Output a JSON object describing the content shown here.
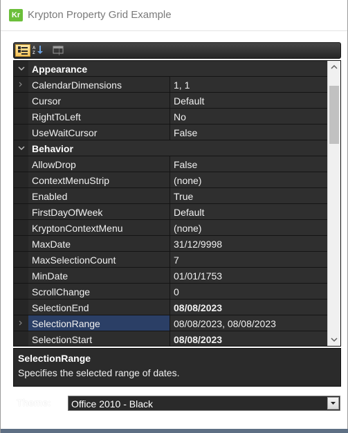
{
  "window": {
    "title": "Krypton Property Grid Example",
    "icon_text": "Kr"
  },
  "toolbar": {
    "buttons": [
      {
        "icon": "categorized-icon",
        "active": true
      },
      {
        "icon": "alphabetical-sort-icon",
        "active": false
      },
      {
        "icon": "property-pages-icon",
        "active": false
      }
    ]
  },
  "grid": {
    "categories": [
      {
        "label": "Appearance",
        "properties": [
          {
            "name": "CalendarDimensions",
            "value": "1, 1",
            "expandable": true,
            "bold": false
          },
          {
            "name": "Cursor",
            "value": "Default",
            "expandable": false,
            "bold": false
          },
          {
            "name": "RightToLeft",
            "value": "No",
            "expandable": false,
            "bold": false
          },
          {
            "name": "UseWaitCursor",
            "value": "False",
            "expandable": false,
            "bold": false
          }
        ]
      },
      {
        "label": "Behavior",
        "properties": [
          {
            "name": "AllowDrop",
            "value": "False",
            "expandable": false,
            "bold": false
          },
          {
            "name": "ContextMenuStrip",
            "value": "(none)",
            "expandable": false,
            "bold": false
          },
          {
            "name": "Enabled",
            "value": "True",
            "expandable": false,
            "bold": false
          },
          {
            "name": "FirstDayOfWeek",
            "value": "Default",
            "expandable": false,
            "bold": false
          },
          {
            "name": "KryptonContextMenu",
            "value": "(none)",
            "expandable": false,
            "bold": false
          },
          {
            "name": "MaxDate",
            "value": "31/12/9998",
            "expandable": false,
            "bold": false
          },
          {
            "name": "MaxSelectionCount",
            "value": "7",
            "expandable": false,
            "bold": false
          },
          {
            "name": "MinDate",
            "value": "01/01/1753",
            "expandable": false,
            "bold": false
          },
          {
            "name": "ScrollChange",
            "value": "0",
            "expandable": false,
            "bold": false
          },
          {
            "name": "SelectionEnd",
            "value": "08/08/2023",
            "expandable": false,
            "bold": true
          },
          {
            "name": "SelectionRange",
            "value": "08/08/2023, 08/08/2023",
            "expandable": true,
            "bold": false,
            "selected": true
          },
          {
            "name": "SelectionStart",
            "value": "08/08/2023",
            "expandable": false,
            "bold": true
          }
        ]
      }
    ]
  },
  "help": {
    "title": "SelectionRange",
    "description": "Specifies the selected range of dates."
  },
  "theme": {
    "label": "Theme:",
    "selected": "Office 2010 - Black"
  }
}
